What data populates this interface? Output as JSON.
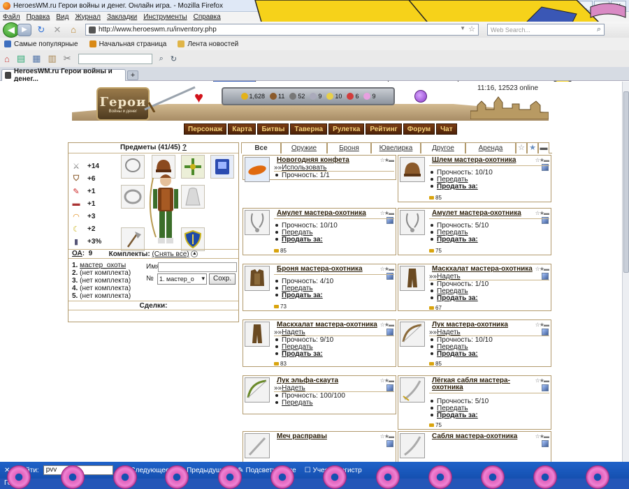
{
  "window": {
    "title": "HeroesWM.ru Герои войны и денег. Онлайн игра. - Mozilla Firefox",
    "controls": [
      "_",
      "□",
      "✕"
    ]
  },
  "menu": [
    "Файл",
    "Правка",
    "Вид",
    "Журнал",
    "Закладки",
    "Инструменты",
    "Справка"
  ],
  "nav": {
    "url": "http://www.heroeswm.ru/inventory.php",
    "search_placeholder": "Web Search..."
  },
  "bookmarks": [
    "Самые популярные",
    "Начальная страница",
    "Лента новостей"
  ],
  "tab": {
    "title": "HeroesWM.ru Герои войны и денег...",
    "new": "+"
  },
  "game": {
    "logo_title": "Герои",
    "logo_sub": "Войны и денег",
    "resources": [
      "1,628",
      "11",
      "52",
      "9",
      "10",
      "6",
      "9"
    ],
    "time": "11:16, 12523 online",
    "menu": [
      "Персонаж",
      "Карта",
      "Битвы",
      "Таверна",
      "Рулетка",
      "Рейтинг",
      "Форум",
      "Чат"
    ]
  },
  "inventory": {
    "heading": "Предметы (41/45)",
    "help": "?",
    "stats": [
      {
        "icon": "sword-icon",
        "glyph": "⚔",
        "value": "+14"
      },
      {
        "icon": "shield-icon",
        "glyph": "⛉",
        "value": "+6"
      },
      {
        "icon": "wand-icon",
        "glyph": "✎",
        "value": "+1"
      },
      {
        "icon": "book-icon",
        "glyph": "▬",
        "value": "+1"
      },
      {
        "icon": "rainbow-icon",
        "glyph": "◠",
        "value": "+3"
      },
      {
        "icon": "moon-icon",
        "glyph": "☾",
        "value": "+2"
      },
      {
        "icon": "cylinder-icon",
        "glyph": "▮",
        "value": "+3%"
      }
    ],
    "oa_label": "ОА",
    "oa_value": "9",
    "sets_title": "Комплекты:",
    "sets_remove": "(Снять все)",
    "sets": [
      {
        "n": "1.",
        "name": "мастер_охоты"
      },
      {
        "n": "2.",
        "name": "(нет комплекта)"
      },
      {
        "n": "3.",
        "name": "(нет комплекта)"
      },
      {
        "n": "4.",
        "name": "(нет комплекта)"
      },
      {
        "n": "5.",
        "name": "(нет комплекта)"
      }
    ],
    "name_label": "Имя",
    "num_label": "№",
    "select_value": "1. мастер_о",
    "save": "Сохр.",
    "deals": "Сделки:"
  },
  "tabs": [
    "Все",
    "Оружие",
    "Броня",
    "Ювелирка",
    "Другое",
    "Аренда"
  ],
  "items": [
    {
      "name": "Новогодняя конфета",
      "action": "Использовать",
      "prefix": "»»",
      "props": [
        "Прочность: 1/1"
      ],
      "price": ""
    },
    {
      "name": "Шлем мастера-охотника",
      "action": "",
      "prefix": "",
      "props": [
        "Прочность: 10/10",
        "Передать",
        "Продать за:"
      ],
      "price": "85"
    },
    {
      "name": "Амулет мастера-охотника",
      "action": "",
      "prefix": "",
      "props": [
        "Прочность: 10/10",
        "Передать",
        "Продать за:"
      ],
      "price": "85"
    },
    {
      "name": "Амулет мастера-охотника",
      "action": "",
      "prefix": "",
      "props": [
        "Прочность: 5/10",
        "Передать",
        "Продать за:"
      ],
      "price": "75"
    },
    {
      "name": "Броня мастера-охотника",
      "action": "",
      "prefix": "",
      "props": [
        "Прочность: 4/10",
        "Передать",
        "Продать за:"
      ],
      "price": "73"
    },
    {
      "name": "Маскхалат мастера-охотника",
      "action": "Надеть",
      "prefix": "»»",
      "props": [
        "Прочность: 1/10",
        "Передать",
        "Продать за:"
      ],
      "price": "67"
    },
    {
      "name": "Маскхалат мастера-охотника",
      "action": "Надеть",
      "prefix": "»»",
      "props": [
        "Прочность: 9/10",
        "Передать",
        "Продать за:"
      ],
      "price": "83"
    },
    {
      "name": "Лук мастера-охотника",
      "action": "Надеть",
      "prefix": "»»",
      "props": [
        "Прочность: 10/10",
        "Передать",
        "Продать за:"
      ],
      "price": "85"
    },
    {
      "name": "Лук эльфа-скаута",
      "action": "Надеть",
      "prefix": "»»",
      "props": [
        "Прочность: 100/100",
        "Передать"
      ],
      "price": ""
    },
    {
      "name": "Лёгкая сабля мастера-охотника",
      "action": "",
      "prefix": "",
      "props": [
        "Прочность: 5/10",
        "Передать",
        "Продать за:"
      ],
      "price": "75"
    },
    {
      "name": "Меч расправы",
      "action": "",
      "prefix": "",
      "props": [],
      "price": ""
    },
    {
      "name": "Сабля мастера-охотника",
      "action": "",
      "prefix": "",
      "props": [],
      "price": ""
    }
  ],
  "find": {
    "label": "Найти:",
    "value": "pvv",
    "next": "Следующее",
    "prev": "Предыдущее",
    "highlight": "Подсветить все",
    "case": "Учесть регистр"
  },
  "status": "Готово",
  "colors": {
    "accent": "#1f62c9",
    "gold": "#d9a40e",
    "brown": "#4d2208"
  }
}
